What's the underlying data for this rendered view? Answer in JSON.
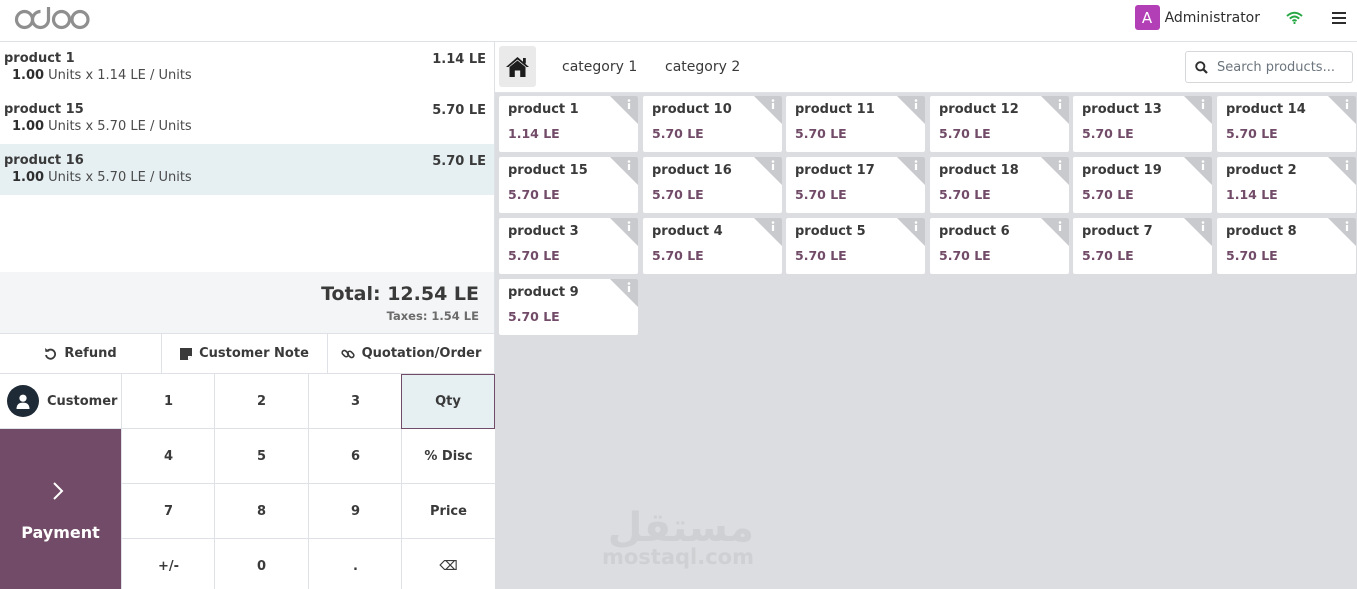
{
  "brand": "odoo",
  "header": {
    "user_initial": "A",
    "user_name": "Administrator"
  },
  "orderlines": [
    {
      "name": "product 1",
      "price": "1.14 LE",
      "qty": "1.00",
      "detail": "Units x 1.14 LE / Units",
      "selected": false
    },
    {
      "name": "product 15",
      "price": "5.70 LE",
      "qty": "1.00",
      "detail": "Units x 5.70 LE / Units",
      "selected": false
    },
    {
      "name": "product 16",
      "price": "5.70 LE",
      "qty": "1.00",
      "detail": "Units x 5.70 LE / Units",
      "selected": true
    }
  ],
  "summary": {
    "total": "Total: 12.54 LE",
    "taxes": "Taxes: 1.54 LE"
  },
  "control_buttons": {
    "refund": "Refund",
    "customer_note": "Customer Note",
    "quotation": "Quotation/Order"
  },
  "customer_label": "Customer",
  "payment_label": "Payment",
  "numpad": [
    "1",
    "2",
    "3",
    "Qty",
    "4",
    "5",
    "6",
    "% Disc",
    "7",
    "8",
    "9",
    "Price",
    "+/-",
    "0",
    ".",
    "⌫"
  ],
  "numpad_active": "Qty",
  "categories": [
    "category 1",
    "category 2"
  ],
  "search": {
    "placeholder": "Search products..."
  },
  "products": [
    {
      "name": "product 1",
      "price": "1.14 LE"
    },
    {
      "name": "product 10",
      "price": "5.70 LE"
    },
    {
      "name": "product 11",
      "price": "5.70 LE"
    },
    {
      "name": "product 12",
      "price": "5.70 LE"
    },
    {
      "name": "product 13",
      "price": "5.70 LE"
    },
    {
      "name": "product 14",
      "price": "5.70 LE"
    },
    {
      "name": "product 15",
      "price": "5.70 LE"
    },
    {
      "name": "product 16",
      "price": "5.70 LE"
    },
    {
      "name": "product 17",
      "price": "5.70 LE"
    },
    {
      "name": "product 18",
      "price": "5.70 LE"
    },
    {
      "name": "product 19",
      "price": "5.70 LE"
    },
    {
      "name": "product 2",
      "price": "1.14 LE"
    },
    {
      "name": "product 3",
      "price": "5.70 LE"
    },
    {
      "name": "product 4",
      "price": "5.70 LE"
    },
    {
      "name": "product 5",
      "price": "5.70 LE"
    },
    {
      "name": "product 6",
      "price": "5.70 LE"
    },
    {
      "name": "product 7",
      "price": "5.70 LE"
    },
    {
      "name": "product 8",
      "price": "5.70 LE"
    },
    {
      "name": "product 9",
      "price": "5.70 LE"
    }
  ],
  "watermark": {
    "arabic": "مستقل",
    "latin": "mostaql.com"
  },
  "colors": {
    "brand": "#714b67",
    "selected_line": "#e6f0f3",
    "wifi": "#28a745",
    "avatar": "#b23fb5"
  }
}
